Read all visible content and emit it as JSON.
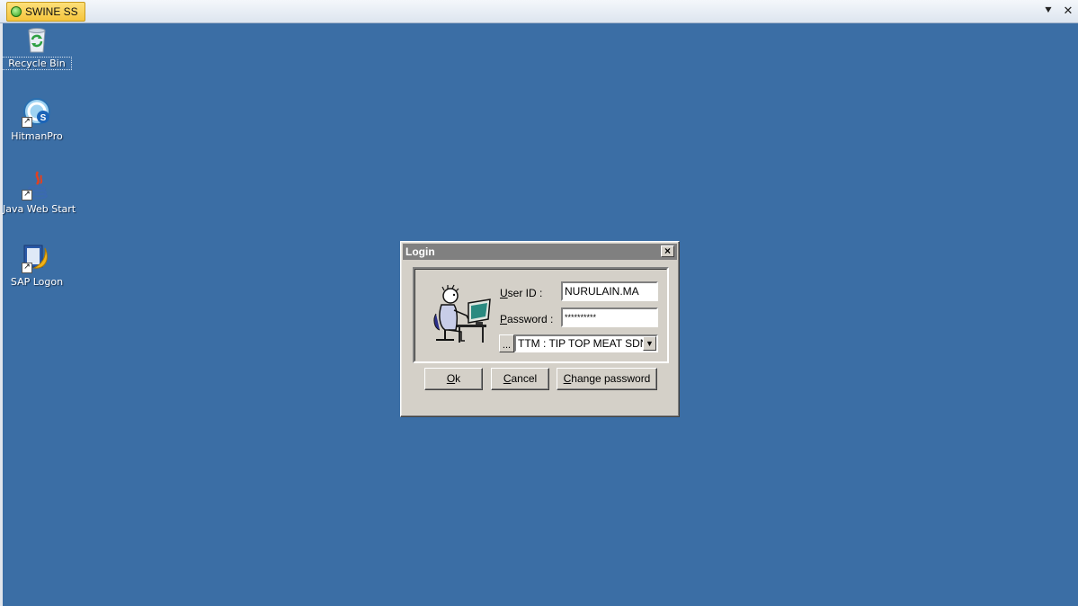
{
  "session_bar": {
    "tab_label": "SWINE SS",
    "menu_glyph": "⯆",
    "close_glyph": "✕"
  },
  "desktop": {
    "icons": [
      {
        "label": "Recycle Bin",
        "icon": "recycle-bin-icon"
      },
      {
        "label": "HitmanPro",
        "icon": "hitmanpro-icon"
      },
      {
        "label": "Java Web Start",
        "icon": "java-icon"
      },
      {
        "label": "SAP Logon",
        "icon": "sap-logon-icon"
      }
    ]
  },
  "login_dialog": {
    "title": "Login",
    "user_id_label": "ser ID :",
    "user_id_accel": "U",
    "user_id_value": "NURULAIN.MA",
    "password_label": "assword :",
    "password_accel": "P",
    "password_value": "**********",
    "browse_label": "...",
    "company_value": "TTM : TIP TOP MEAT SDN BHD",
    "ok_accel": "O",
    "ok_rest": "k",
    "cancel_accel": "C",
    "cancel_rest": "ancel",
    "change_accel": "C",
    "change_rest": "hange password"
  },
  "colors": {
    "desktop_bg": "#3b6ea5",
    "dialog_bg": "#d4d0c8",
    "titlebar_inactive": "#808080"
  }
}
